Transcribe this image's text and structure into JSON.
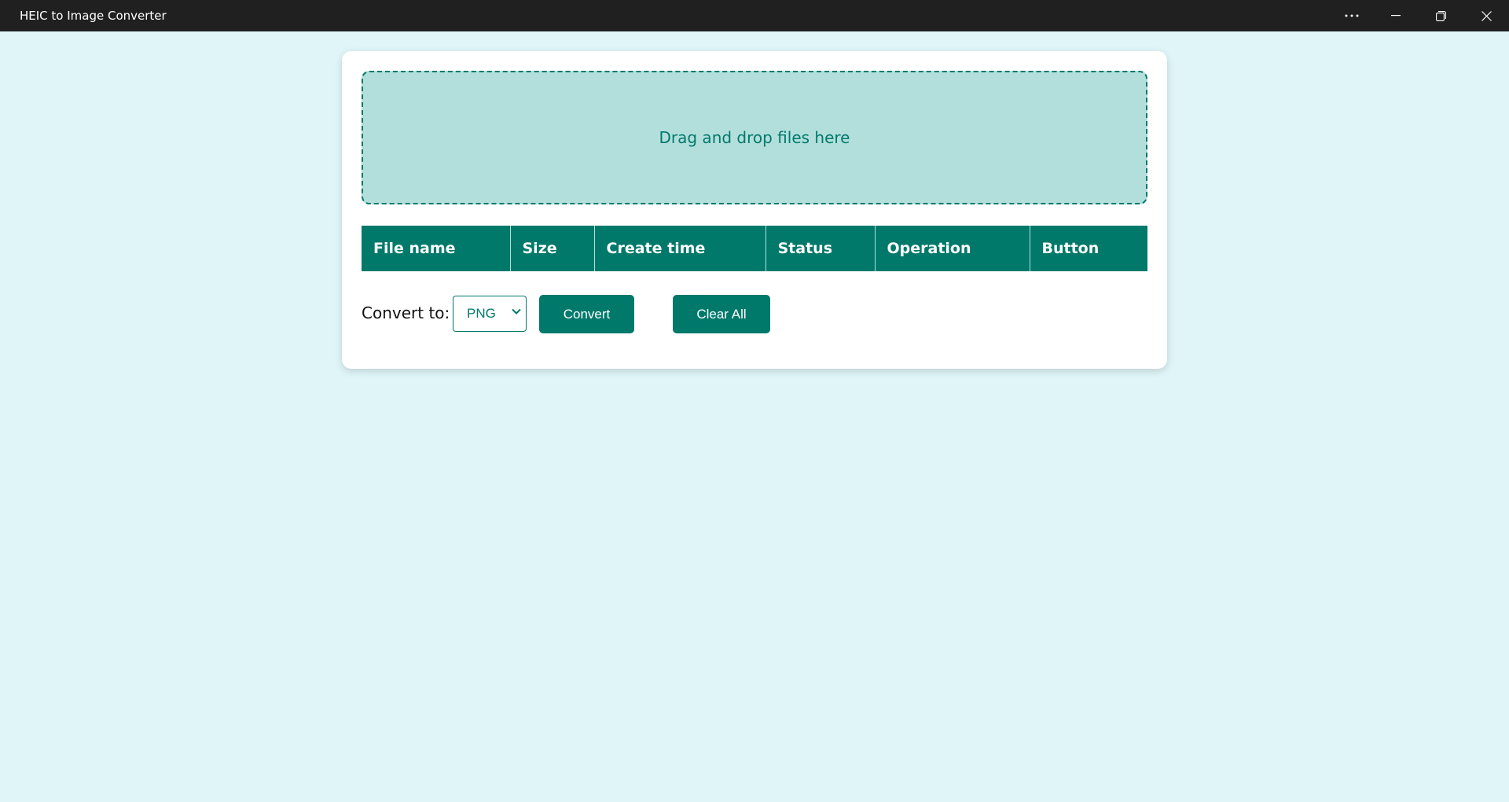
{
  "window": {
    "title": "HEIC to Image Converter",
    "controls": [
      "more-icon",
      "minimize-icon",
      "restore-icon",
      "close-icon"
    ]
  },
  "dropzone": {
    "text": "Drag and drop files here"
  },
  "table": {
    "columns": [
      "File name",
      "Size",
      "Create time",
      "Status",
      "Operation",
      "Button"
    ],
    "rows": []
  },
  "controls": {
    "convert_label": "Convert to:",
    "format_selected": "PNG",
    "convert_button": "Convert",
    "clear_button": "Clear All"
  },
  "colors": {
    "accent": "#00796b",
    "dropzone_bg": "#b2dfdc",
    "page_bg": "#dff5f7",
    "titlebar_bg": "#202020"
  }
}
